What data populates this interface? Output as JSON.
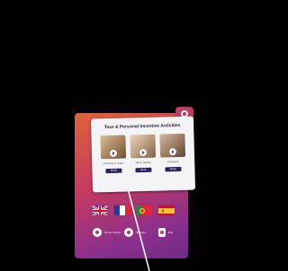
{
  "card": {
    "title": "Tour & Personal Incentive Activities",
    "items": [
      {
        "caption": "Cooking & Tapas",
        "button_label": "Book"
      },
      {
        "caption": "Wine Tasting",
        "button_label": "Book"
      },
      {
        "caption": "Flamenco",
        "button_label": "Book"
      }
    ]
  },
  "flags": [
    {
      "icon": "uk-flag-icon"
    },
    {
      "icon": "france-flag-icon"
    },
    {
      "icon": "portugal-flag-icon"
    },
    {
      "icon": "spain-flag-icon"
    }
  ],
  "actions": [
    {
      "icon": "home-icon",
      "label": "Home Screen"
    },
    {
      "icon": "settings-icon",
      "label": "Settings"
    },
    {
      "icon": "exit-icon",
      "label": "Exit"
    }
  ],
  "colors": {
    "background": "#010101",
    "panel_gradient_start": "#e0623a",
    "panel_gradient_end": "#6f2a86",
    "card": "#f4f4f6",
    "button": "#2c2060"
  }
}
